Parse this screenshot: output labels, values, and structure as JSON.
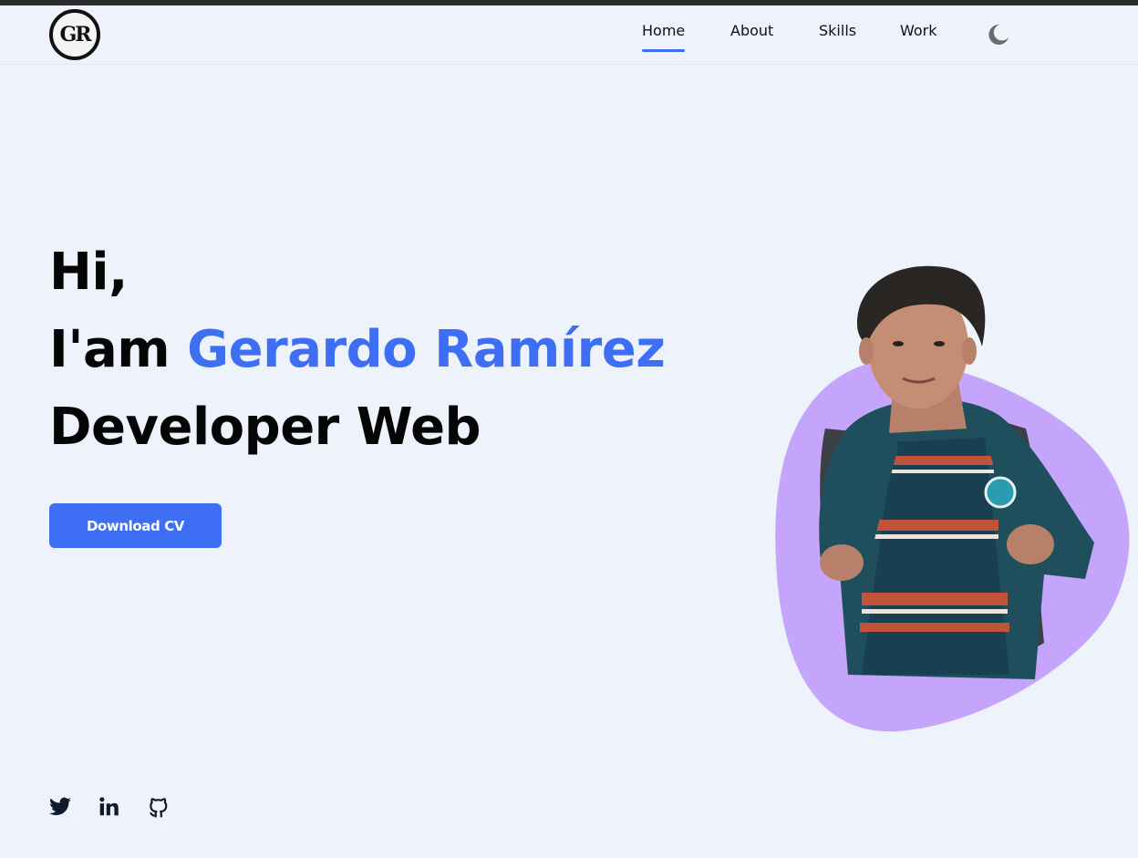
{
  "header": {
    "logo_text": "GR",
    "nav": [
      {
        "label": "Home",
        "active": true
      },
      {
        "label": "About",
        "active": false
      },
      {
        "label": "Skills",
        "active": false
      },
      {
        "label": "Work",
        "active": false
      }
    ],
    "theme_toggle_icon": "moon-icon"
  },
  "hero": {
    "greeting": "Hi,",
    "intro_prefix": "I'am ",
    "name": "Gerardo Ramírez",
    "role": "Developer Web",
    "cv_button": "Download CV",
    "accent_color": "#3d6ef3",
    "blob_color": "#c4a5fb",
    "photo": "person-photo"
  },
  "social": [
    {
      "icon": "twitter-icon"
    },
    {
      "icon": "linkedin-icon"
    },
    {
      "icon": "github-icon"
    }
  ]
}
